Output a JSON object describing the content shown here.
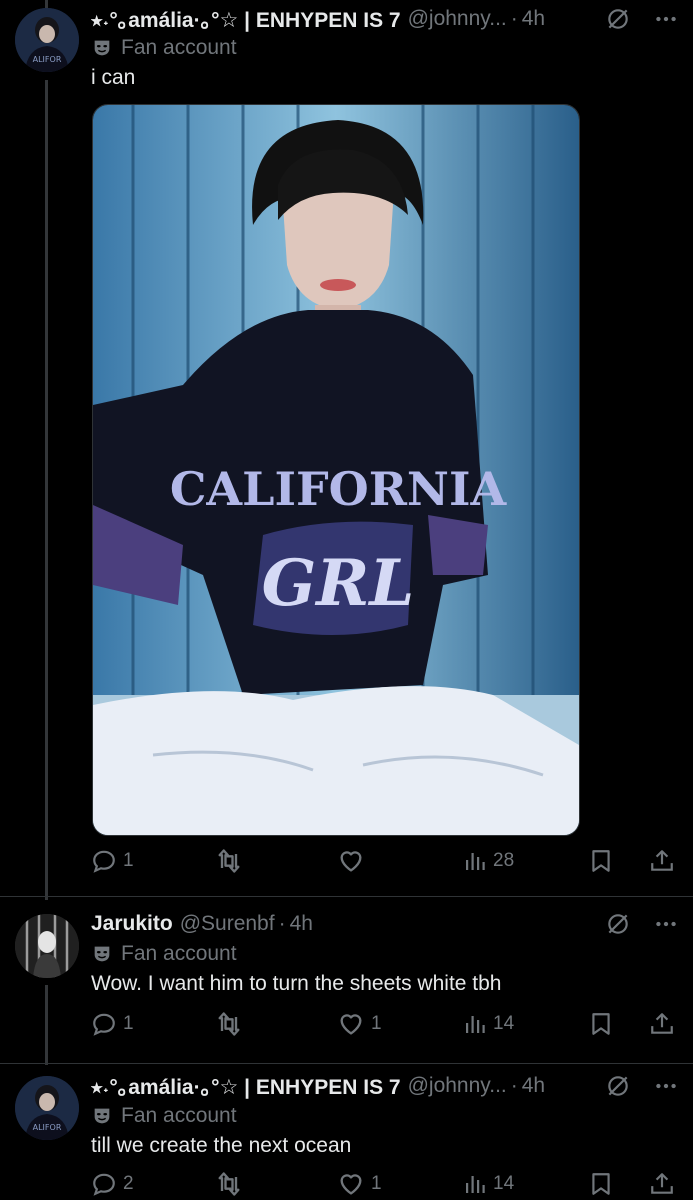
{
  "tweets": [
    {
      "name": "⭒˖°｡amália·｡°☆ | ENHYPEN IS 7",
      "handle": "@johnny...",
      "time": "4h",
      "badge": "Fan account",
      "text": "i can",
      "actions": {
        "replies": "1",
        "retweets": "",
        "likes": "",
        "views": "28"
      },
      "photo": {
        "print_line_1": "CALIFORNIA",
        "print_line_2": "GRL"
      }
    },
    {
      "name": "Jarukito",
      "handle": "@Surenbf",
      "time": "4h",
      "badge": "Fan account",
      "text": "Wow. I want him to turn the sheets white tbh",
      "actions": {
        "replies": "1",
        "retweets": "",
        "likes": "1",
        "views": "14"
      }
    },
    {
      "name": "⭒˖°｡amália·｡°☆ | ENHYPEN IS 7",
      "handle": "@johnny...",
      "time": "4h",
      "badge": "Fan account",
      "text": "till we create the next ocean",
      "actions": {
        "replies": "2",
        "retweets": "",
        "likes": "1",
        "views": "14"
      }
    }
  ],
  "dot": "·",
  "colors": {
    "background": "#000000",
    "text": "#e7e9ea",
    "muted": "#71767b",
    "divider": "#2f3336"
  },
  "icons": [
    "grok-icon",
    "more-icon",
    "fan-mask-icon",
    "reply-icon",
    "retweet-icon",
    "like-icon",
    "views-icon",
    "bookmark-icon",
    "share-icon"
  ]
}
